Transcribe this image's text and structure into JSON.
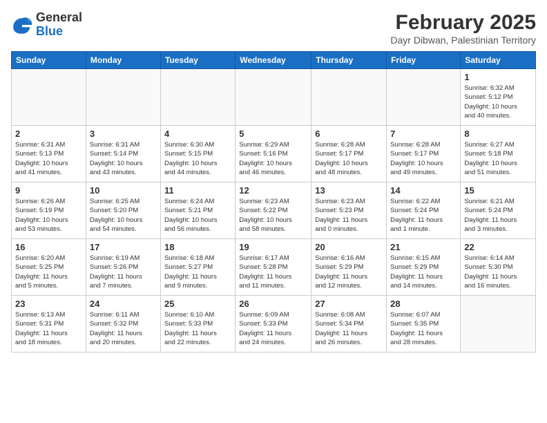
{
  "header": {
    "logo_general": "General",
    "logo_blue": "Blue",
    "month_title": "February 2025",
    "location": "Dayr Dibwan, Palestinian Territory"
  },
  "weekdays": [
    "Sunday",
    "Monday",
    "Tuesday",
    "Wednesday",
    "Thursday",
    "Friday",
    "Saturday"
  ],
  "weeks": [
    [
      {
        "day": "",
        "info": ""
      },
      {
        "day": "",
        "info": ""
      },
      {
        "day": "",
        "info": ""
      },
      {
        "day": "",
        "info": ""
      },
      {
        "day": "",
        "info": ""
      },
      {
        "day": "",
        "info": ""
      },
      {
        "day": "1",
        "info": "Sunrise: 6:32 AM\nSunset: 5:12 PM\nDaylight: 10 hours\nand 40 minutes."
      }
    ],
    [
      {
        "day": "2",
        "info": "Sunrise: 6:31 AM\nSunset: 5:13 PM\nDaylight: 10 hours\nand 41 minutes."
      },
      {
        "day": "3",
        "info": "Sunrise: 6:31 AM\nSunset: 5:14 PM\nDaylight: 10 hours\nand 43 minutes."
      },
      {
        "day": "4",
        "info": "Sunrise: 6:30 AM\nSunset: 5:15 PM\nDaylight: 10 hours\nand 44 minutes."
      },
      {
        "day": "5",
        "info": "Sunrise: 6:29 AM\nSunset: 5:16 PM\nDaylight: 10 hours\nand 46 minutes."
      },
      {
        "day": "6",
        "info": "Sunrise: 6:28 AM\nSunset: 5:17 PM\nDaylight: 10 hours\nand 48 minutes."
      },
      {
        "day": "7",
        "info": "Sunrise: 6:28 AM\nSunset: 5:17 PM\nDaylight: 10 hours\nand 49 minutes."
      },
      {
        "day": "8",
        "info": "Sunrise: 6:27 AM\nSunset: 5:18 PM\nDaylight: 10 hours\nand 51 minutes."
      }
    ],
    [
      {
        "day": "9",
        "info": "Sunrise: 6:26 AM\nSunset: 5:19 PM\nDaylight: 10 hours\nand 53 minutes."
      },
      {
        "day": "10",
        "info": "Sunrise: 6:25 AM\nSunset: 5:20 PM\nDaylight: 10 hours\nand 54 minutes."
      },
      {
        "day": "11",
        "info": "Sunrise: 6:24 AM\nSunset: 5:21 PM\nDaylight: 10 hours\nand 56 minutes."
      },
      {
        "day": "12",
        "info": "Sunrise: 6:23 AM\nSunset: 5:22 PM\nDaylight: 10 hours\nand 58 minutes."
      },
      {
        "day": "13",
        "info": "Sunrise: 6:23 AM\nSunset: 5:23 PM\nDaylight: 11 hours\nand 0 minutes."
      },
      {
        "day": "14",
        "info": "Sunrise: 6:22 AM\nSunset: 5:24 PM\nDaylight: 11 hours\nand 1 minute."
      },
      {
        "day": "15",
        "info": "Sunrise: 6:21 AM\nSunset: 5:24 PM\nDaylight: 11 hours\nand 3 minutes."
      }
    ],
    [
      {
        "day": "16",
        "info": "Sunrise: 6:20 AM\nSunset: 5:25 PM\nDaylight: 11 hours\nand 5 minutes."
      },
      {
        "day": "17",
        "info": "Sunrise: 6:19 AM\nSunset: 5:26 PM\nDaylight: 11 hours\nand 7 minutes."
      },
      {
        "day": "18",
        "info": "Sunrise: 6:18 AM\nSunset: 5:27 PM\nDaylight: 11 hours\nand 9 minutes."
      },
      {
        "day": "19",
        "info": "Sunrise: 6:17 AM\nSunset: 5:28 PM\nDaylight: 11 hours\nand 11 minutes."
      },
      {
        "day": "20",
        "info": "Sunrise: 6:16 AM\nSunset: 5:29 PM\nDaylight: 11 hours\nand 12 minutes."
      },
      {
        "day": "21",
        "info": "Sunrise: 6:15 AM\nSunset: 5:29 PM\nDaylight: 11 hours\nand 14 minutes."
      },
      {
        "day": "22",
        "info": "Sunrise: 6:14 AM\nSunset: 5:30 PM\nDaylight: 11 hours\nand 16 minutes."
      }
    ],
    [
      {
        "day": "23",
        "info": "Sunrise: 6:13 AM\nSunset: 5:31 PM\nDaylight: 11 hours\nand 18 minutes."
      },
      {
        "day": "24",
        "info": "Sunrise: 6:11 AM\nSunset: 5:32 PM\nDaylight: 11 hours\nand 20 minutes."
      },
      {
        "day": "25",
        "info": "Sunrise: 6:10 AM\nSunset: 5:33 PM\nDaylight: 11 hours\nand 22 minutes."
      },
      {
        "day": "26",
        "info": "Sunrise: 6:09 AM\nSunset: 5:33 PM\nDaylight: 11 hours\nand 24 minutes."
      },
      {
        "day": "27",
        "info": "Sunrise: 6:08 AM\nSunset: 5:34 PM\nDaylight: 11 hours\nand 26 minutes."
      },
      {
        "day": "28",
        "info": "Sunrise: 6:07 AM\nSunset: 5:35 PM\nDaylight: 11 hours\nand 28 minutes."
      },
      {
        "day": "",
        "info": ""
      }
    ]
  ]
}
